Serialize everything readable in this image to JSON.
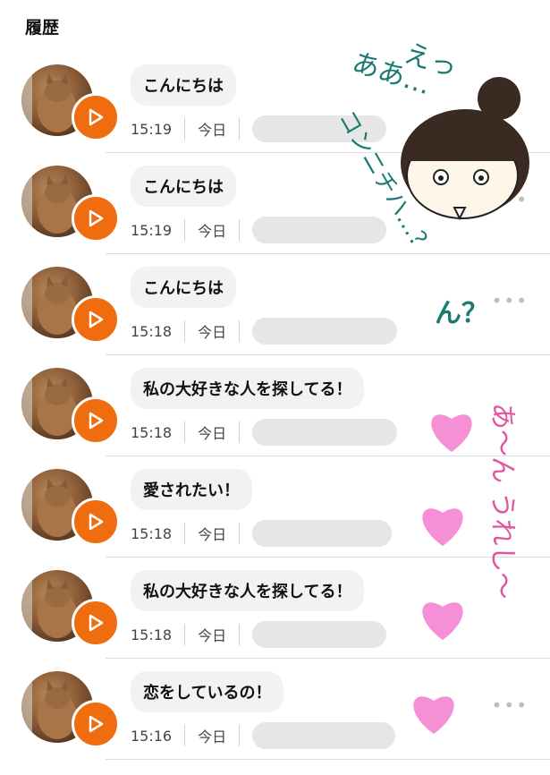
{
  "header": {
    "title": "履歴"
  },
  "rows": [
    {
      "message": "こんにちは",
      "time": "15:19",
      "day": "今日"
    },
    {
      "message": "こんにちは",
      "time": "15:19",
      "day": "今日"
    },
    {
      "message": "こんにちは",
      "time": "15:18",
      "day": "今日"
    },
    {
      "message": "私の大好きな人を探してる！",
      "time": "15:18",
      "day": "今日"
    },
    {
      "message": "愛されたい！",
      "time": "15:18",
      "day": "今日"
    },
    {
      "message": "私の大好きな人を探してる！",
      "time": "15:18",
      "day": "今日"
    },
    {
      "message": "恋をしているの！",
      "time": "15:16",
      "day": "今日"
    }
  ],
  "annotations": {
    "note1": "えっ",
    "note2": "ああ…",
    "note3": "コンニチハ…？",
    "note4": "ん？",
    "note5": "あ〜ん うれし〜"
  },
  "colors": {
    "accent": "#ef6c0f",
    "heart": "#f58fd6",
    "ink_teal": "#1a7a72",
    "ink_pink": "#e0559e"
  }
}
